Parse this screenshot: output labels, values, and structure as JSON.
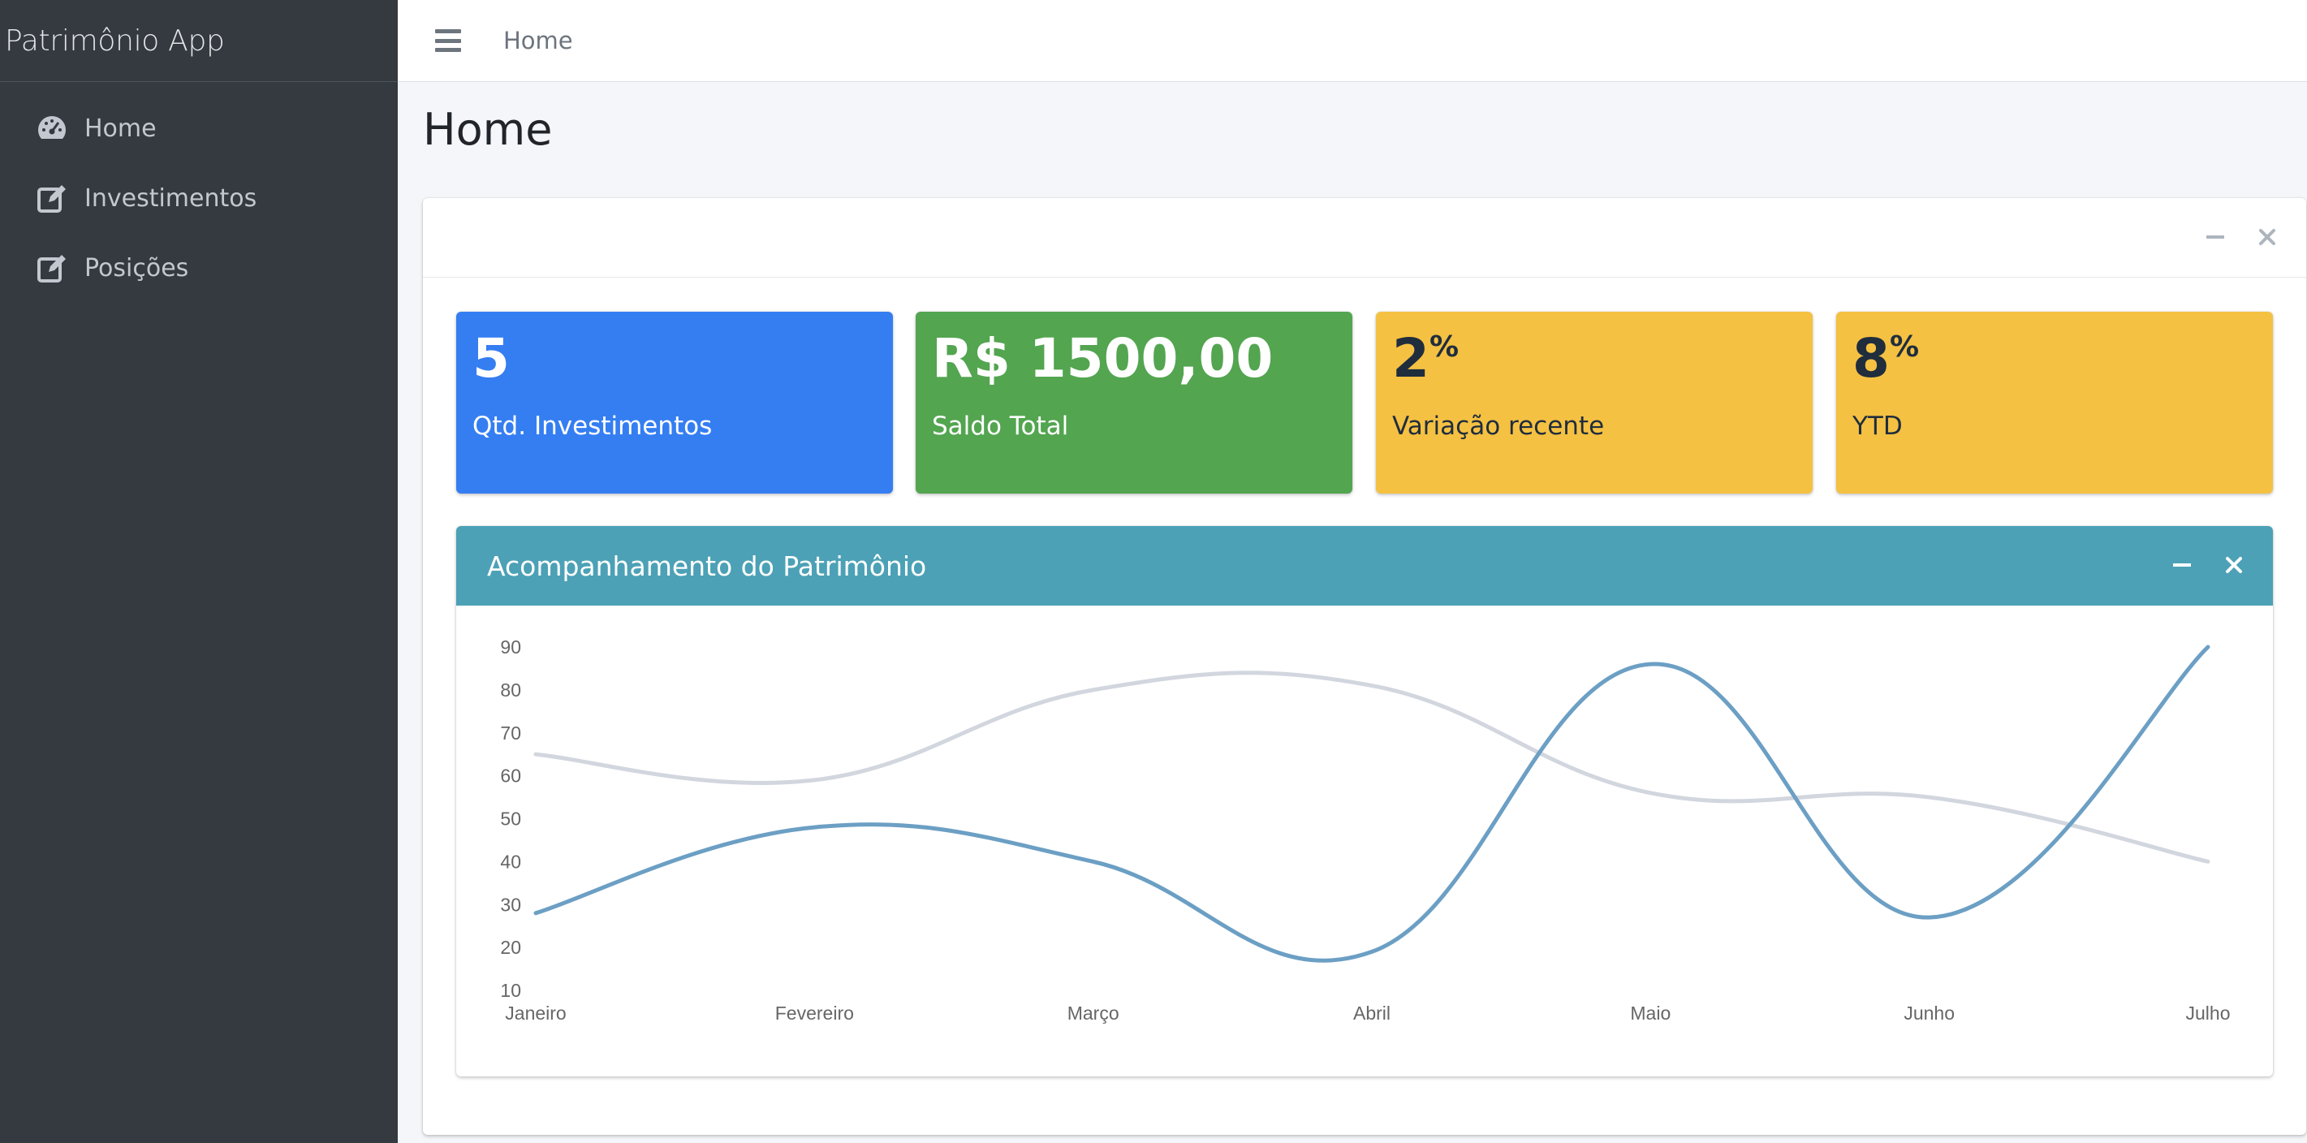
{
  "app": {
    "brand": "Patrimônio App"
  },
  "sidebar": {
    "items": [
      {
        "label": "Home",
        "icon": "tachometer-icon"
      },
      {
        "label": "Investimentos",
        "icon": "edit-icon"
      },
      {
        "label": "Posições",
        "icon": "edit-icon"
      }
    ]
  },
  "topbar": {
    "home_link": "Home"
  },
  "page": {
    "title": "Home"
  },
  "stats": [
    {
      "value": "5",
      "suffix": "",
      "label": "Qtd. Investimentos",
      "color": "#357ef2"
    },
    {
      "value": "R$ 1500,00",
      "suffix": "",
      "label": "Saldo Total",
      "color": "#53a550"
    },
    {
      "value": "2",
      "suffix": "%",
      "label": "Variação recente",
      "color": "#f5c142"
    },
    {
      "value": "8",
      "suffix": "%",
      "label": "YTD",
      "color": "#f5c142"
    }
  ],
  "chart_card": {
    "title": "Acompanhamento do Patrimônio",
    "header_color": "#4ca1b6"
  },
  "chart_data": {
    "type": "line",
    "title": "",
    "xlabel": "",
    "ylabel": "",
    "categories": [
      "Janeiro",
      "Fevereiro",
      "Março",
      "Abril",
      "Maio",
      "Junho",
      "Julho"
    ],
    "x_tick_labels": [
      "Janeiro",
      "Fevereiro",
      "Março",
      "Abril",
      "Maio",
      "Junho",
      "Julho"
    ],
    "y_ticks": [
      10,
      20,
      30,
      40,
      50,
      60,
      70,
      80,
      90
    ],
    "ylim": [
      10,
      90
    ],
    "grid": false,
    "smooth": true,
    "series": [
      {
        "values": [
          65,
          59,
          80,
          81,
          56,
          55,
          40
        ],
        "color": "#d2d6de"
      },
      {
        "values": [
          28,
          48,
          40,
          19,
          86,
          27,
          90
        ],
        "color": "#6c9fc4"
      }
    ]
  }
}
